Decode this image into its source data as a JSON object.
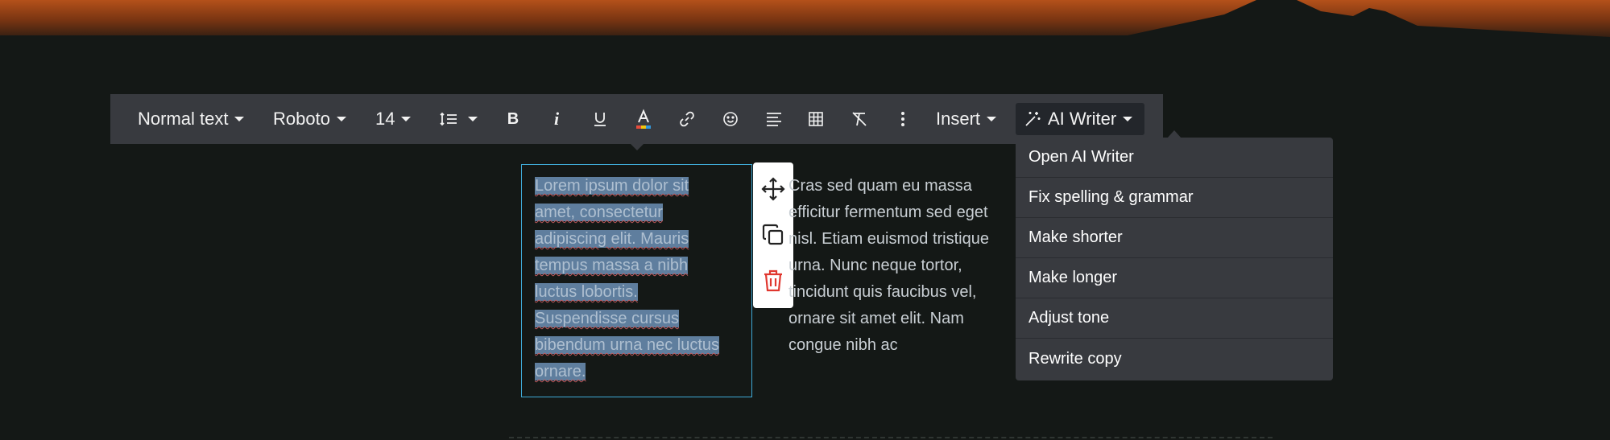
{
  "toolbar": {
    "text_style": "Normal text",
    "font_family": "Roboto",
    "font_size": "14",
    "insert_label": "Insert",
    "ai_writer_label": "AI Writer",
    "icons": [
      "line-spacing-icon",
      "bold-icon",
      "italic-icon",
      "underline-icon",
      "text-color-icon",
      "link-icon",
      "emoji-icon",
      "align-icon",
      "table-icon",
      "clear-format-icon",
      "more-vertical-icon",
      "magic-wand-icon"
    ]
  },
  "ai_menu": {
    "items": [
      "Open AI Writer",
      "Fix spelling & grammar",
      "Make shorter",
      "Make longer",
      "Adjust tone",
      "Rewrite copy"
    ]
  },
  "content": {
    "left_column": "Lorem ipsum dolor sit amet, consectetur adipiscing elit. Mauris tempus massa a nibh luctus lobortis. Suspendisse cursus bibendum urna nec luctus ornare.",
    "right_column": "Cras sed quam eu massa efficitur fermentum sed eget nisl. Etiam euismod tristique urna. Nunc neque tortor, tincidunt quis faucibus vel, ornare sit amet elit. Nam congue nibh ac"
  },
  "block_tools": {
    "icons": [
      "move-icon",
      "duplicate-icon",
      "delete-icon"
    ]
  },
  "colors": {
    "toolbar_bg": "#383a3f",
    "selection": "#5f7e9e",
    "focus_border": "#3fa9d6",
    "delete": "#e0372f"
  }
}
